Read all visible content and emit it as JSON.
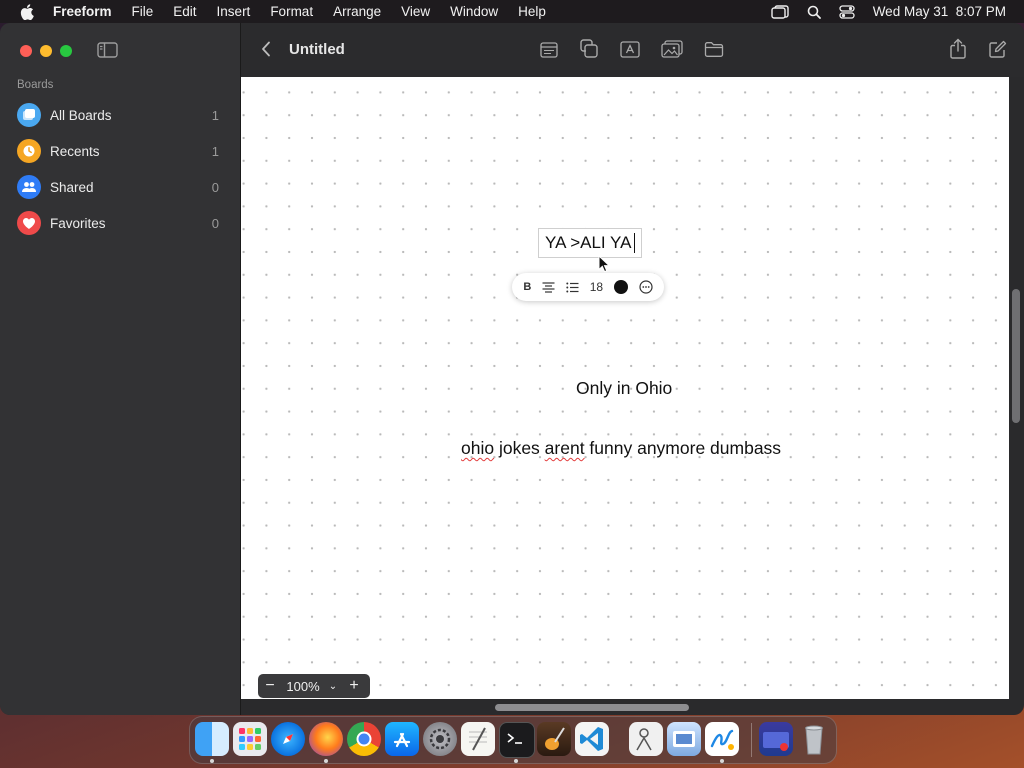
{
  "menubar": {
    "app_name": "Freeform",
    "menus": [
      "File",
      "Edit",
      "Insert",
      "Format",
      "Arrange",
      "View",
      "Window",
      "Help"
    ],
    "datetime": "Wed May 31  8:07 PM"
  },
  "sidebar": {
    "heading": "Boards",
    "items": [
      {
        "label": "All Boards",
        "count": "1",
        "icon": "boards-icon",
        "color": "#4aa8f0"
      },
      {
        "label": "Recents",
        "count": "1",
        "icon": "clock-icon",
        "color": "#f5a623"
      },
      {
        "label": "Shared",
        "count": "0",
        "icon": "people-icon",
        "color": "#2f7cf6"
      },
      {
        "label": "Favorites",
        "count": "0",
        "icon": "heart-icon",
        "color": "#ef4a4a"
      }
    ]
  },
  "toolbar": {
    "title": "Untitled",
    "buttons": [
      "sticky-note-icon",
      "shapes-icon",
      "text-box-icon",
      "media-icon",
      "files-icon",
      "share-icon",
      "compose-icon"
    ]
  },
  "canvas": {
    "editing_text": "YA >ALI YA",
    "format_bar": {
      "bold_label": "B",
      "font_size": "18",
      "text_color": "#111111"
    },
    "texts": [
      {
        "id": "ohio-title",
        "text": "Only in Ohio"
      },
      {
        "id": "ohio-line",
        "parts": [
          "ohio",
          " jokes ",
          "arent",
          " funny anymore dumbass"
        ]
      }
    ],
    "zoom": "100%"
  },
  "dock": {
    "apps": [
      "finder-icon",
      "launchpad-icon",
      "safari-icon",
      "firefox-icon",
      "chrome-icon",
      "app-store-icon",
      "system-settings-icon",
      "textedit-icon",
      "terminal-icon",
      "garageband-icon",
      "vscode-icon",
      "preview-icon",
      "photos-icon",
      "freeform-icon",
      "downloads-icon",
      "trash-icon"
    ]
  }
}
